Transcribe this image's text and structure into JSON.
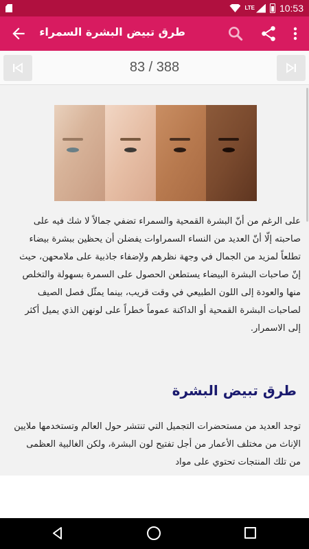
{
  "status_bar": {
    "time": "10:53",
    "network": "LTE",
    "icons": [
      "sd-card-icon",
      "wifi-icon",
      "signal-icon",
      "battery-icon"
    ]
  },
  "app_bar": {
    "title": "طرق تبيض البشرة السمراء",
    "icons": [
      "arrow-back-icon",
      "search-icon",
      "share-icon",
      "more-vert-icon"
    ],
    "color": "#d81b60"
  },
  "pager": {
    "counter": "83 / 388",
    "icons": [
      "skip-first-icon",
      "skip-last-icon"
    ]
  },
  "article": {
    "paragraph1": "على الرغم من أنّ البشرة القمحية والسمراء تضفي جمالاً لا شك فيه على صاحبته إلّا أنّ العديد من النساء السمراوات يفضلن أن يحظين ببشرة بيضاء تطلعاً لمزيد من الجمال في وجهة نظرهم ولإضفاء جاذبية على ملامحهن، حيث إنّ صاحبات البشرة البيضاء يستطعن الحصول على السمرة بسهولة والتخلص منها والعودة إلى اللون الطبيعي في وقت قريب، بينما يمثّل فصل الصيف لصاحبات البشرة القمحية أو الداكنة عموماً خطراً على لونهن الذي يميل أكثر إلى الاسمرار.",
    "heading": "طرق تبيض البشرة",
    "paragraph2": "توجد العديد من مستحضرات التجميل التي تنتشر حول العالم وتستخدمها ملايين الإناث من مختلف الأعمار من أجل تفتيح لون البشرة، ولكن الغالبية العظمى من تلك المنتجات تحتوي على مواد"
  },
  "nav_bar": {
    "icons": [
      "nav-back-icon",
      "nav-home-icon",
      "nav-recents-icon"
    ]
  }
}
